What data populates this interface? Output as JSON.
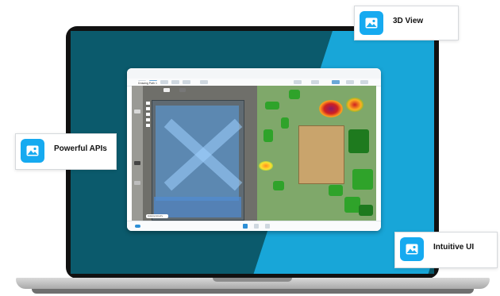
{
  "callouts": {
    "top": {
      "label": "3D View",
      "icon": "image-icon"
    },
    "left": {
      "label": "Powerful APIs",
      "icon": "image-icon"
    },
    "bottom": {
      "label": "Intuitive UI",
      "icon": "image-icon"
    }
  },
  "app": {
    "drawing_tab": "Drawing Path 1",
    "bottom_chip": "Autosymmetry"
  },
  "colors": {
    "brand_blue": "#16aaf0",
    "screen_bg": "#0b5a6c",
    "screen_accent": "#18a6d8"
  }
}
